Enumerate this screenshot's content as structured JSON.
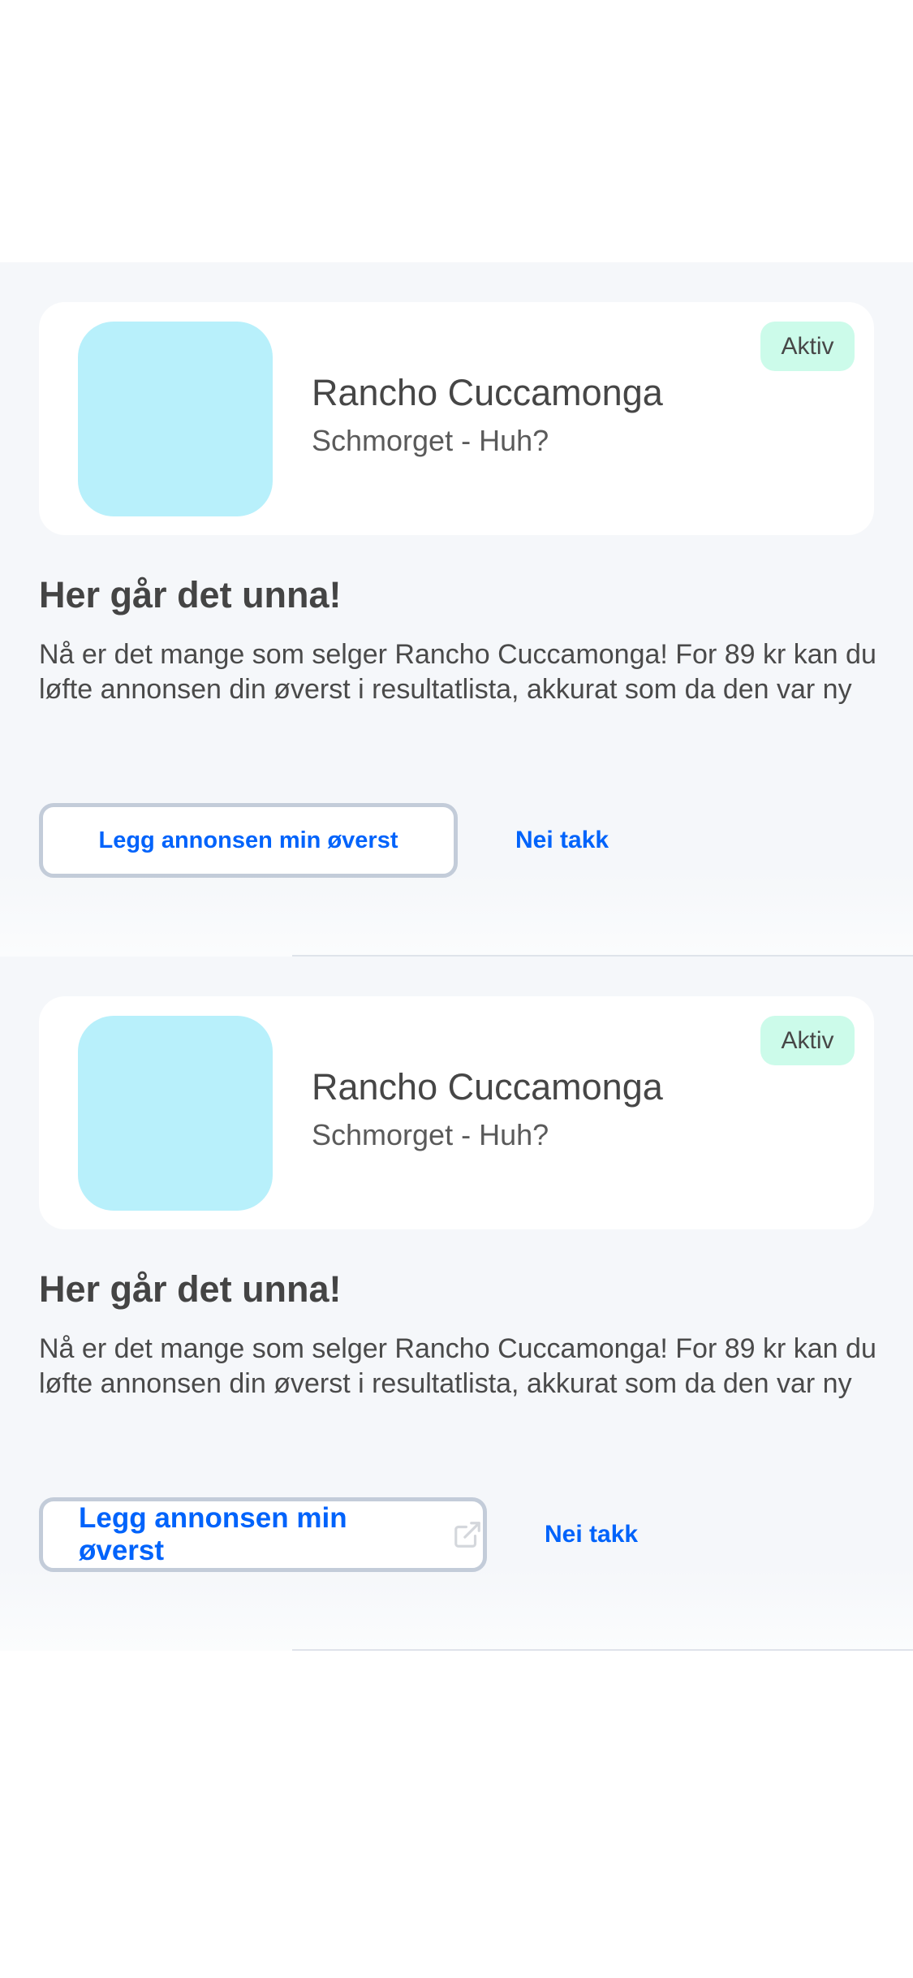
{
  "cards": [
    {
      "badge": "Aktiv",
      "title": "Rancho Cuccamonga",
      "subtitle": "Schmorget - Huh?",
      "heading": "Her går det unna!",
      "body": "Nå er det mange som selger Rancho Cuccamonga! For 89 kr kan du løfte annonsen din øverst i resultatlista, akkurat som da den var ny",
      "primary_button": "Legg annonsen min øverst",
      "secondary_button": "Nei takk"
    },
    {
      "badge": "Aktiv",
      "title": "Rancho Cuccamonga",
      "subtitle": "Schmorget - Huh?",
      "heading": "Her går det unna!",
      "body": "Nå er det mange som selger Rancho Cuccamonga! For 89 kr kan du løfte annonsen din øverst i resultatlista, akkurat som da den var ny",
      "primary_button": "Legg annonsen min øverst",
      "primary_icon": "external-link-icon",
      "secondary_button": "Nei takk"
    }
  ],
  "colors": {
    "accent": "#0063fb",
    "badge_bg": "#ccfbea",
    "thumbnail": "#b8f0fb",
    "section_bg": "#f5f7fa"
  }
}
